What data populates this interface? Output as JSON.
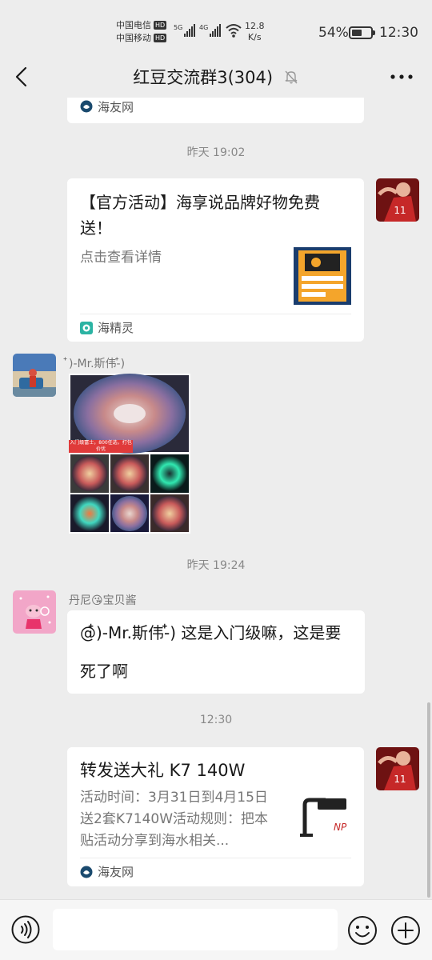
{
  "status": {
    "carrier1": "中国电信",
    "carrier2": "中国移动",
    "hd": "HD",
    "net1": "5G",
    "net2": "4G",
    "speed_value": "12.8",
    "speed_unit": "K/s",
    "battery": "54%",
    "battery_level": 0.54,
    "time": "12:30"
  },
  "header": {
    "title": "红豆交流群3(304)"
  },
  "messages": {
    "top_card": {
      "source": "海友网"
    },
    "time1": "昨天 19:02",
    "promo_card": {
      "title": "【官方活动】海享说品牌好物免费送！",
      "desc": "点击查看详情",
      "source": "海精灵"
    },
    "coral_msg": {
      "sender": "໋)-Mr.斯伟-໋)",
      "overlay_text": "入门级富士，800任选，打包价优"
    },
    "time2": "昨天 19:24",
    "text_msg": {
      "sender": "丹尼😘宝贝酱",
      "text": "@໋)-Mr.斯伟-໋) 这是入门级嘛，这是要死了啊"
    },
    "time3": "12:30",
    "share_card": {
      "title": "转发送大礼 K7 140W",
      "desc": "活动时间：3月31日到4月15日送2套K7140W活动规则：把本贴活动分享到海水相关...",
      "source": "海友网",
      "thumb_brand": "NP"
    }
  },
  "input": {
    "placeholder": ""
  },
  "colors": {
    "background": "#ededed",
    "bubble": "#ffffff",
    "timestamp": "#888888",
    "overlay_red": "#e03a3a"
  }
}
